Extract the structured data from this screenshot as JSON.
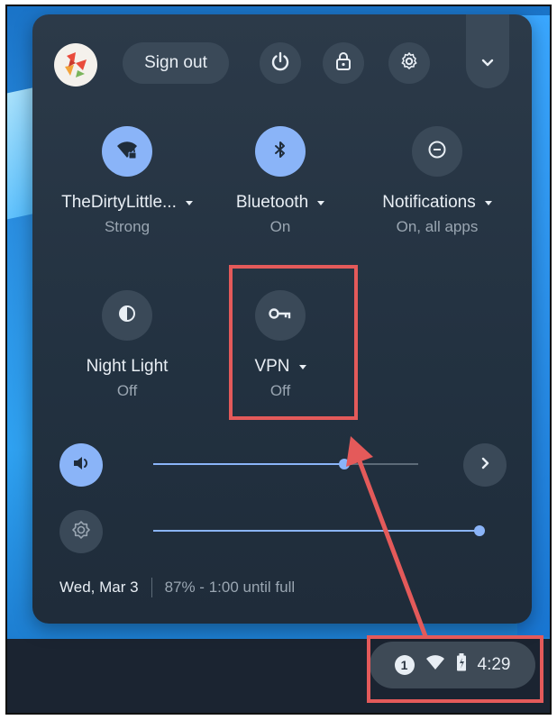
{
  "quick_settings": {
    "sign_out_label": "Sign out",
    "icons": {
      "power": "power-icon",
      "lock": "lock-icon",
      "settings": "gear-icon",
      "collapse": "chevron-down-icon"
    },
    "tiles": [
      {
        "id": "wifi",
        "label": "TheDirtyLittle...",
        "sub": "Strong",
        "state": "on",
        "has_menu": true,
        "icon": "wifi-lock-icon"
      },
      {
        "id": "bluetooth",
        "label": "Bluetooth",
        "sub": "On",
        "state": "on",
        "has_menu": true,
        "icon": "bluetooth-icon"
      },
      {
        "id": "notifications",
        "label": "Notifications",
        "sub": "On, all apps",
        "state": "off",
        "has_menu": true,
        "icon": "do-not-disturb-icon"
      },
      {
        "id": "night_light",
        "label": "Night Light",
        "sub": "Off",
        "state": "off",
        "has_menu": false,
        "icon": "night-light-icon"
      },
      {
        "id": "vpn",
        "label": "VPN",
        "sub": "Off",
        "state": "off",
        "has_menu": true,
        "icon": "key-icon"
      }
    ],
    "sliders": {
      "volume": {
        "icon": "volume-icon",
        "level_percent": 72,
        "state": "on"
      },
      "brightness": {
        "icon": "brightness-icon",
        "level_percent": 100,
        "state": "off"
      }
    },
    "footer": {
      "date": "Wed, Mar 3",
      "battery": "87% - 1:00 until full"
    }
  },
  "shelf": {
    "status_area": {
      "notification_count": "1",
      "time": "4:29",
      "icons": [
        "wifi-icon",
        "battery-charging-icon"
      ]
    }
  },
  "annotation": {
    "highlight_color": "#e45a5a"
  }
}
